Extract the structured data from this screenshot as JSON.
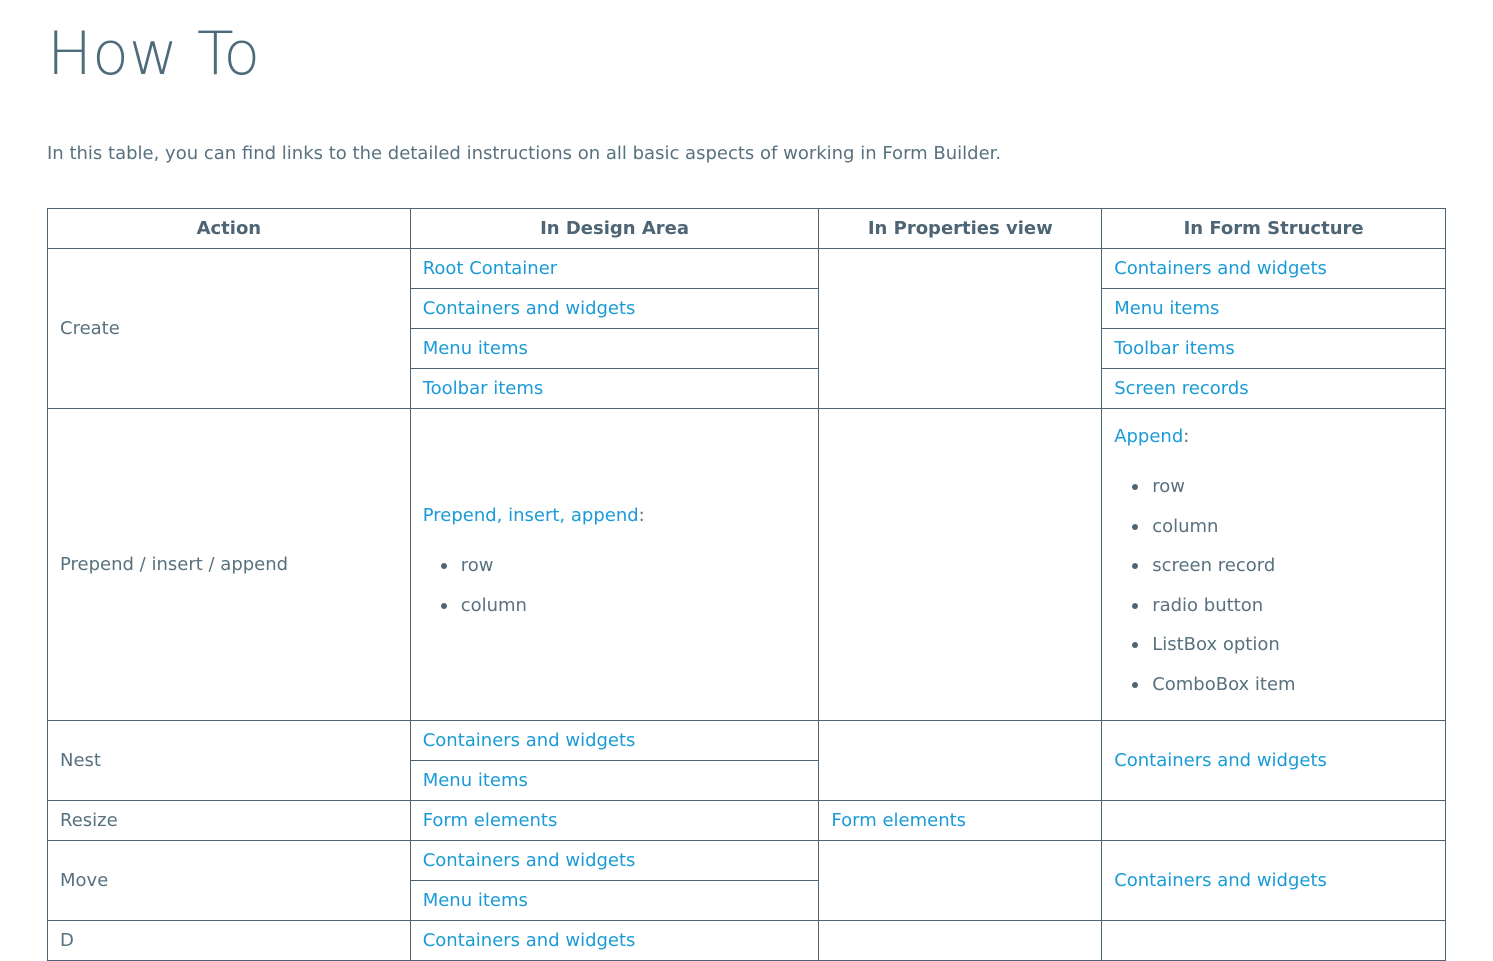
{
  "page": {
    "title": "How To",
    "intro": "In this table, you can find links to the detailed instructions on all basic aspects of working in Form Builder."
  },
  "table": {
    "headers": [
      "Action",
      "In Design Area",
      "In Properties view",
      "In Form Structure"
    ],
    "create": {
      "action": "Create",
      "design": [
        "Root Container",
        "Containers and widgets",
        "Menu items",
        "Toolbar items"
      ],
      "structure": [
        "Containers and widgets",
        "Menu items",
        "Toolbar items",
        "Screen records"
      ]
    },
    "prepend": {
      "action": "Prepend / insert / append",
      "design_link": "Prepend, insert, append",
      "design_items": [
        "row",
        "column"
      ],
      "structure_link": "Append",
      "structure_items": [
        "row",
        "column",
        "screen record",
        "radio button",
        "ListBox option",
        "ComboBox item"
      ],
      "colon": ":"
    },
    "nest": {
      "action": "Nest",
      "design": [
        "Containers and widgets",
        "Menu items"
      ],
      "structure": "Containers and widgets"
    },
    "resize": {
      "action": "Resize",
      "design": "Form elements",
      "properties": "Form elements"
    },
    "move": {
      "action": "Move",
      "design": [
        "Containers and widgets",
        "Menu items"
      ],
      "structure": "Containers and widgets"
    },
    "partial_row": {
      "action": "D",
      "design": "Containers and widgets"
    }
  },
  "colors": {
    "link": "#1a9bd7",
    "text": "#58717f",
    "heading": "#4d6b7a",
    "border": "#4d6574"
  }
}
